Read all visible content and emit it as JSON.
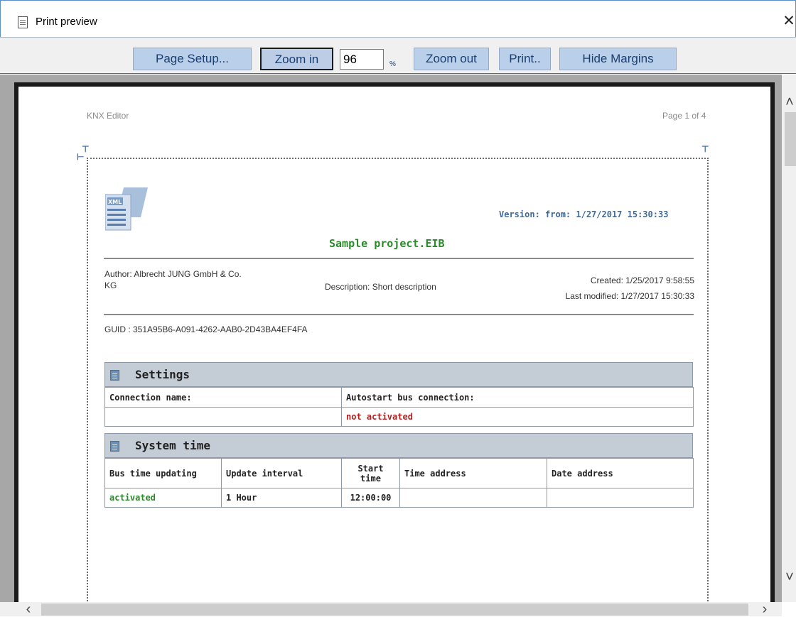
{
  "window": {
    "title": "Print preview",
    "close_glyph": "✕"
  },
  "toolbar": {
    "page_setup": "Page Setup...",
    "zoom_in": "Zoom in",
    "zoom_value": "96",
    "zoom_unit": "%",
    "zoom_out": "Zoom out",
    "print": "Print..",
    "hide_margins": "Hide Margins"
  },
  "page": {
    "header_left": "KNX Editor",
    "header_right": "Page 1 of 4",
    "version_text": "Version:   from: 1/27/2017 15:30:33",
    "project_title": "Sample project.EIB",
    "author_line1": "Author:  Albrecht JUNG GmbH & Co.",
    "author_line2": "KG",
    "description": "Description:  Short description",
    "created": "Created:  1/25/2017 9:58:55",
    "last_modified": "Last modified:  1/27/2017 15:30:33",
    "guid": "GUID :  351A95B6-A091-4262-AAB0-2D43BA4EF4FA"
  },
  "settings": {
    "title": "Settings",
    "headers": [
      "Connection name:",
      "Autostart bus connection:"
    ],
    "values": [
      "",
      "not activated"
    ]
  },
  "system_time": {
    "title": "System time",
    "headers": [
      "Bus time updating",
      "Update interval",
      "Start time",
      "Time address",
      "Date address"
    ],
    "values": [
      "activated",
      "1 Hour",
      "12:00:00",
      "",
      ""
    ]
  },
  "icons": {
    "document": "document-icon",
    "close": "close-icon",
    "xml": "xml-file-icon",
    "section": "section-xml-icon"
  },
  "colors": {
    "button_bg": "#bad0ea",
    "title_green": "#2a8a2a",
    "version_blue": "#3f6a9c",
    "not_activated_red": "#b81e1e",
    "section_header": "#c4ccd6"
  }
}
